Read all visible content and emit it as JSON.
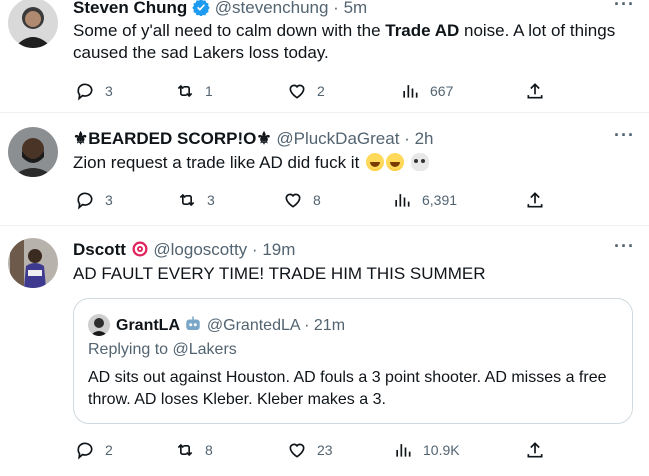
{
  "tweets": [
    {
      "name": "Steven Chung",
      "handle": "@stevenchung",
      "sep": "·",
      "time": "5m",
      "text_pre": "Some of y'all need to calm down with the ",
      "text_bold": "Trade AD",
      "text_post": " noise. A lot of things caused the sad Lakers loss today.",
      "replies": "3",
      "retweets": "1",
      "likes": "2",
      "views": "667"
    },
    {
      "name": "⚜BEARDED SCORP!O⚜",
      "handle": "@PluckDaGreat",
      "sep": "·",
      "time": "2h",
      "text": "Zion request a trade like AD did fuck it",
      "replies": "3",
      "retweets": "3",
      "likes": "8",
      "views": "6,391"
    },
    {
      "name": "Dscott",
      "handle": "@logoscotty",
      "sep": "·",
      "time": "19m",
      "text": "AD FAULT EVERY TIME! TRADE HIM THIS SUMMER",
      "replies": "2",
      "retweets": "8",
      "likes": "23",
      "views": "10.9K",
      "quote": {
        "name": "GrantLA",
        "handle": "@GrantedLA",
        "sep": "·",
        "time": "21m",
        "replying_label": "Replying to",
        "replying_to": "@Lakers",
        "text": "AD sits out against Houston. AD fouls a 3 point shooter. AD misses a free throw. AD loses Kleber. Kleber makes a 3."
      }
    }
  ],
  "more_label": "···",
  "colors": {
    "text": "#0f1419",
    "secondary": "#536471",
    "verified_blue": "#1d9bf0",
    "border": "#cfd9de"
  }
}
